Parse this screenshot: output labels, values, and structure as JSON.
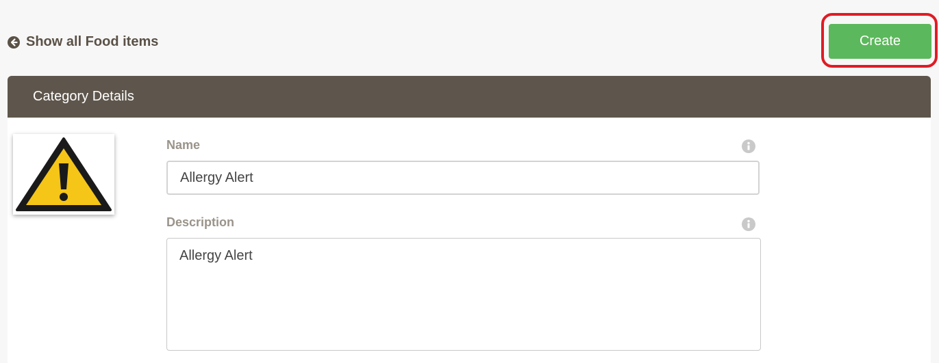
{
  "nav": {
    "back_label": "Show all Food items",
    "back_icon": "arrow-left-circle-icon"
  },
  "toolbar": {
    "create_label": "Create",
    "create_color": "#5cb85c",
    "highlight_color": "#e01b24"
  },
  "panel": {
    "title": "Category Details",
    "header_color": "#5e564c",
    "image_icon": "warning-triangle-icon"
  },
  "form": {
    "name": {
      "label": "Name",
      "value": "Allergy Alert",
      "info_icon": "info-icon"
    },
    "description": {
      "label": "Description",
      "value": "Allergy Alert",
      "info_icon": "info-icon"
    }
  }
}
